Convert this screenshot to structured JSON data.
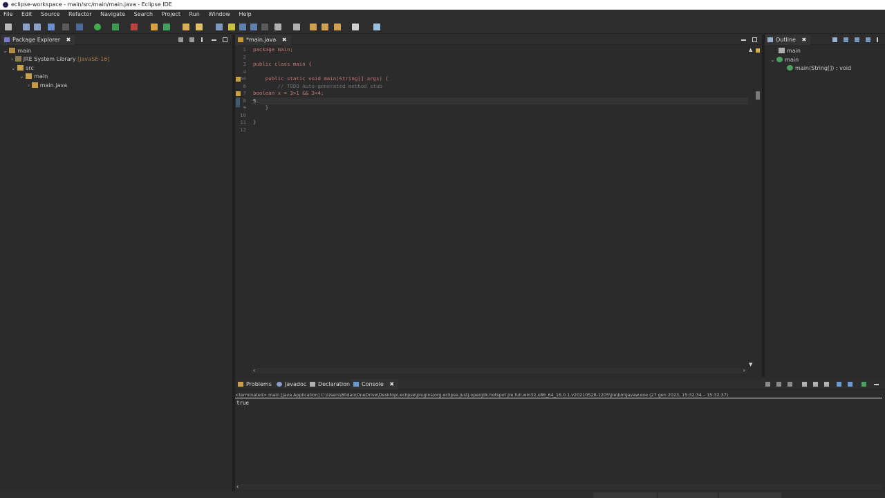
{
  "window": {
    "title": "eclipse-workspace - main/src/main/main.java - Eclipse IDE"
  },
  "menu": [
    "File",
    "Edit",
    "Source",
    "Refactor",
    "Navigate",
    "Search",
    "Project",
    "Run",
    "Window",
    "Help"
  ],
  "package_explorer": {
    "tab_label": "Package Explorer",
    "close": "✖",
    "tree": [
      {
        "label": "main",
        "icon": "project-icon",
        "extra": ""
      },
      {
        "label": "JRE System Library",
        "icon": "library-icon",
        "extra": "[JavaSE-16]"
      },
      {
        "label": "src",
        "icon": "source-folder-icon",
        "extra": ""
      },
      {
        "label": "main",
        "icon": "package-icon",
        "extra": ""
      },
      {
        "label": "main.java",
        "icon": "java-file-icon",
        "extra": ""
      }
    ]
  },
  "editor": {
    "tab_label": "*main.java",
    "close": "✖",
    "lines": [
      {
        "n": "1",
        "t": "package main;"
      },
      {
        "n": "2",
        "t": ""
      },
      {
        "n": "3",
        "t": "public class main {"
      },
      {
        "n": "4",
        "t": ""
      },
      {
        "n": "5⊖",
        "t": "    public static void main(String[] args) {"
      },
      {
        "n": "6",
        "t": "        // TODO Auto-generated method stub"
      },
      {
        "n": "7",
        "t": "boolean x = 3>1 && 3<4;"
      },
      {
        "n": "8",
        "t": "S"
      },
      {
        "n": "9",
        "t": "    }"
      },
      {
        "n": "10",
        "t": ""
      },
      {
        "n": "11",
        "t": "}"
      },
      {
        "n": "12",
        "t": ""
      }
    ]
  },
  "outline": {
    "tab_label": "Outline",
    "close": "✖",
    "items": [
      {
        "label": "main",
        "icon": "package-icon"
      },
      {
        "label": "main",
        "icon": "class-icon"
      },
      {
        "label": "main(String[]) : void",
        "icon": "method-icon"
      }
    ]
  },
  "bottom": {
    "tabs": [
      {
        "label": "Problems",
        "icon": "problems-icon"
      },
      {
        "label": "Javadoc",
        "icon": "javadoc-icon"
      },
      {
        "label": "Declaration",
        "icon": "declaration-icon"
      },
      {
        "label": "Console",
        "icon": "console-icon"
      }
    ],
    "close": "✖",
    "console_header": "<terminated> main [Java Application] C:\\Users\\80dan\\OneDrive\\Desktop\\.eclipse\\plugins\\org.eclipse.justj.openjdk.hotspot.jre.full.win32.x86_64_16.0.1.v20210528-1205\\jre\\bin\\javaw.exe  (27 gen 2023, 15:32:34 – 15:32:37)",
    "console_output": "true"
  },
  "colors": {
    "accent": "#4a88c7",
    "background": "#2b2b2b",
    "keyword": "#c97a76"
  }
}
